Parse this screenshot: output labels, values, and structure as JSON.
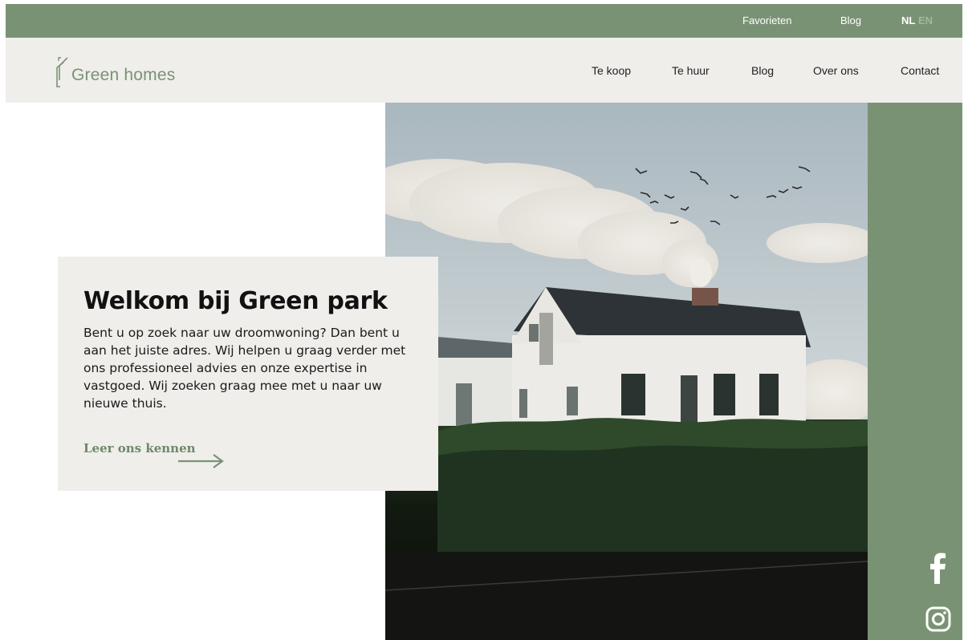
{
  "topbar": {
    "favorites": "Favorieten",
    "blog": "Blog",
    "lang_nl": "NL",
    "lang_en": "EN"
  },
  "header": {
    "logo_text": "Green homes",
    "nav": [
      "Te koop",
      "Te huur",
      "Blog",
      "Over ons",
      "Contact"
    ]
  },
  "hero": {
    "title": "Welkom bij Green park",
    "body": "Bent u op zoek naar uw droomwoning? Dan bent u aan het juiste adres. Wij helpen u graag verder met ons professioneel advies en onze expertise in vastgoed. Wij zoeken graag mee met u naar uw nieuwe thuis.",
    "cta": "Leer ons kennen"
  },
  "social": [
    "facebook-icon",
    "instagram-icon"
  ],
  "colors": {
    "brand_green": "#7a9274",
    "light_bg": "#efeeeb",
    "inactive_lang": "#a3b79c"
  }
}
